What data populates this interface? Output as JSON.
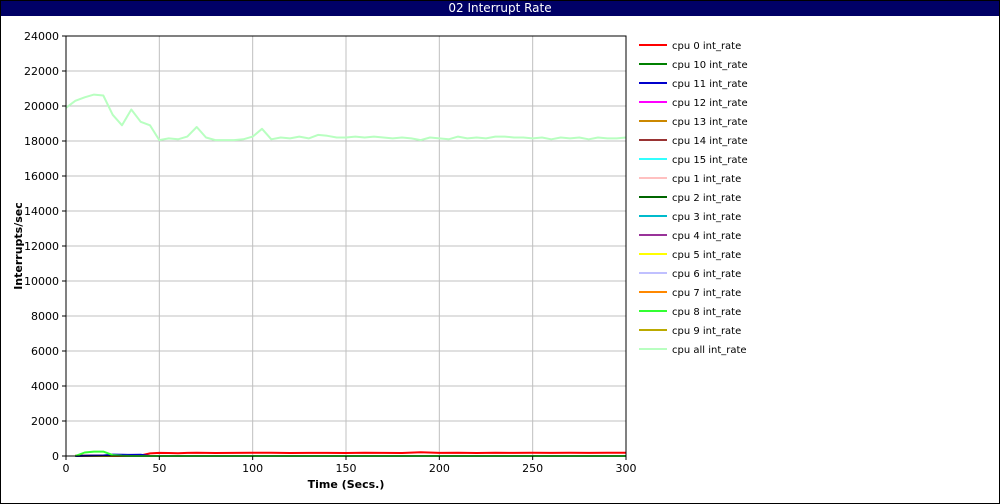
{
  "window": {
    "title": "02 Interrupt Rate"
  },
  "chart_data": {
    "type": "line",
    "title": "02 Interrupt Rate",
    "xlabel": "Time (Secs.)",
    "ylabel": "Interrupts/sec",
    "xlim": [
      0,
      300
    ],
    "ylim": [
      0,
      24000
    ],
    "xticks": [
      0,
      50,
      100,
      150,
      200,
      250,
      300
    ],
    "yticks": [
      0,
      2000,
      4000,
      6000,
      8000,
      10000,
      12000,
      14000,
      16000,
      18000,
      20000,
      22000,
      24000
    ],
    "grid": true,
    "legend_position": "right",
    "series": [
      {
        "name": "cpu 0 int_rate",
        "color": "#ff0000",
        "x": [
          5,
          10,
          15,
          20,
          25,
          30,
          35,
          40,
          45,
          50,
          55,
          60,
          65,
          70,
          75,
          80,
          90,
          100,
          110,
          120,
          130,
          140,
          150,
          160,
          170,
          180,
          190,
          200,
          210,
          220,
          230,
          240,
          250,
          260,
          270,
          280,
          290,
          300
        ],
        "y": [
          20,
          20,
          30,
          30,
          20,
          20,
          30,
          30,
          150,
          180,
          170,
          160,
          180,
          190,
          180,
          170,
          180,
          190,
          190,
          170,
          180,
          180,
          170,
          190,
          180,
          170,
          210,
          180,
          190,
          170,
          190,
          180,
          190,
          180,
          190,
          180,
          190,
          190
        ]
      },
      {
        "name": "cpu 10 int_rate",
        "color": "#008000",
        "x": [
          5,
          300
        ],
        "y": [
          0,
          0
        ]
      },
      {
        "name": "cpu 11 int_rate",
        "color": "#0000cc",
        "x": [
          5,
          10,
          15,
          20,
          25,
          30,
          35,
          40,
          45,
          50,
          300
        ],
        "y": [
          0,
          10,
          20,
          30,
          80,
          70,
          60,
          70,
          0,
          0,
          0
        ]
      },
      {
        "name": "cpu 12 int_rate",
        "color": "#ff00ff",
        "x": [
          5,
          300
        ],
        "y": [
          0,
          0
        ]
      },
      {
        "name": "cpu 13 int_rate",
        "color": "#cc8800",
        "x": [
          5,
          300
        ],
        "y": [
          0,
          0
        ]
      },
      {
        "name": "cpu 14 int_rate",
        "color": "#993333",
        "x": [
          5,
          300
        ],
        "y": [
          0,
          0
        ]
      },
      {
        "name": "cpu 15 int_rate",
        "color": "#33ffff",
        "x": [
          5,
          300
        ],
        "y": [
          0,
          0
        ]
      },
      {
        "name": "cpu 1 int_rate",
        "color": "#ffc0c0",
        "x": [
          5,
          300
        ],
        "y": [
          0,
          0
        ]
      },
      {
        "name": "cpu 2 int_rate",
        "color": "#006600",
        "x": [
          5,
          300
        ],
        "y": [
          0,
          0
        ]
      },
      {
        "name": "cpu 3 int_rate",
        "color": "#00bbcc",
        "x": [
          5,
          300
        ],
        "y": [
          0,
          0
        ]
      },
      {
        "name": "cpu 4 int_rate",
        "color": "#993399",
        "x": [
          5,
          300
        ],
        "y": [
          0,
          0
        ]
      },
      {
        "name": "cpu 5 int_rate",
        "color": "#ffff00",
        "x": [
          5,
          300
        ],
        "y": [
          0,
          0
        ]
      },
      {
        "name": "cpu 6 int_rate",
        "color": "#c0c0ff",
        "x": [
          5,
          300
        ],
        "y": [
          0,
          0
        ]
      },
      {
        "name": "cpu 7 int_rate",
        "color": "#ff8800",
        "x": [
          5,
          300
        ],
        "y": [
          0,
          0
        ]
      },
      {
        "name": "cpu 8 int_rate",
        "color": "#33ff33",
        "x": [
          5,
          10,
          15,
          20,
          25,
          30,
          35,
          40,
          300
        ],
        "y": [
          0,
          200,
          250,
          250,
          50,
          10,
          0,
          0,
          0
        ]
      },
      {
        "name": "cpu 9 int_rate",
        "color": "#bbaa00",
        "x": [
          5,
          300
        ],
        "y": [
          0,
          0
        ]
      },
      {
        "name": "cpu all int_rate",
        "color": "#b8ffc0",
        "x": [
          0,
          5,
          10,
          15,
          20,
          25,
          30,
          35,
          40,
          45,
          50,
          55,
          60,
          65,
          70,
          75,
          80,
          85,
          90,
          95,
          100,
          105,
          110,
          115,
          120,
          125,
          130,
          135,
          140,
          145,
          150,
          155,
          160,
          165,
          170,
          175,
          180,
          185,
          190,
          195,
          200,
          205,
          210,
          215,
          220,
          225,
          230,
          235,
          240,
          245,
          250,
          255,
          260,
          265,
          270,
          275,
          280,
          285,
          290,
          295,
          300
        ],
        "y": [
          19900,
          20300,
          20500,
          20650,
          20600,
          19500,
          18900,
          19800,
          19100,
          18900,
          18050,
          18150,
          18100,
          18250,
          18800,
          18200,
          18050,
          18050,
          18050,
          18100,
          18250,
          18700,
          18100,
          18200,
          18150,
          18250,
          18150,
          18350,
          18300,
          18200,
          18200,
          18250,
          18200,
          18250,
          18200,
          18150,
          18200,
          18150,
          18050,
          18200,
          18150,
          18100,
          18250,
          18150,
          18200,
          18150,
          18250,
          18250,
          18200,
          18200,
          18150,
          18200,
          18100,
          18200,
          18150,
          18200,
          18100,
          18200,
          18150,
          18150,
          18200
        ]
      }
    ]
  }
}
